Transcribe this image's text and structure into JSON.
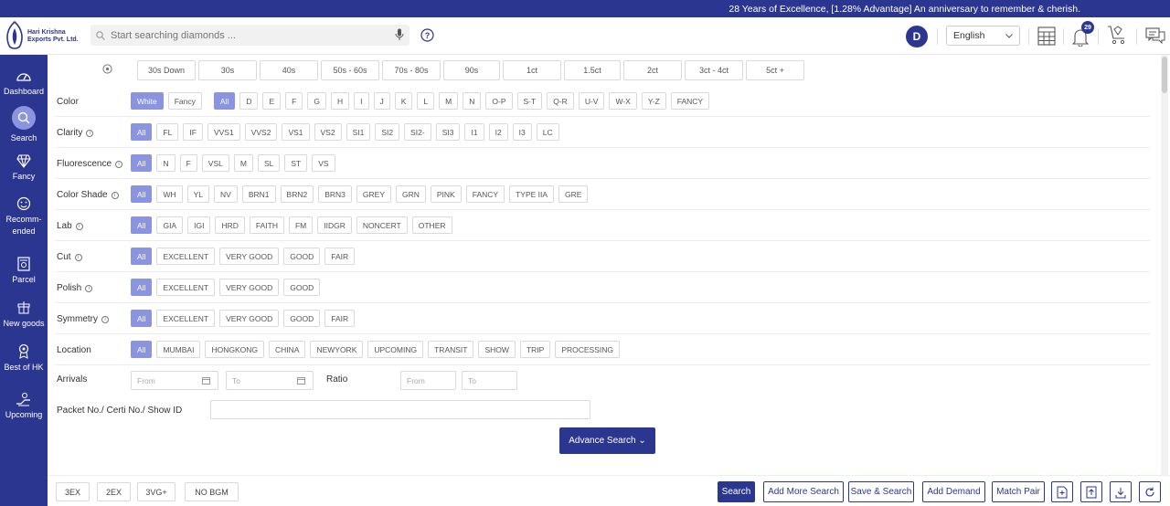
{
  "topbar": {
    "message": "28 Years of Excellence, [1.28% Advantage] An anniversary to remember & cherish."
  },
  "header": {
    "logo_line1": "Hari Krishna",
    "logo_line2": "Exports Pvt. Ltd.",
    "search_placeholder": "Start searching diamonds ...",
    "avatar_initial": "D",
    "language": "English",
    "notification_count": "29"
  },
  "sidebar": [
    {
      "label": "Dashboard",
      "icon": "dashboard-icon"
    },
    {
      "label": "Search",
      "icon": "search-icon",
      "active": true
    },
    {
      "label": "Fancy",
      "icon": "diamond-icon"
    },
    {
      "label": "Recomm-ended",
      "icon": "smile-icon"
    },
    {
      "label": "Parcel",
      "icon": "parcel-icon"
    },
    {
      "label": "New goods",
      "icon": "new-goods-icon"
    },
    {
      "label": "Best of HK",
      "icon": "medal-icon"
    },
    {
      "label": "Upcoming",
      "icon": "upcoming-icon"
    }
  ],
  "sizes": [
    "30s Down",
    "30s",
    "40s",
    "50s - 60s",
    "70s - 80s",
    "90s",
    "1ct",
    "1.5ct",
    "2ct",
    "3ct - 4ct",
    "5ct +"
  ],
  "filters": [
    {
      "label": "Color",
      "info": false,
      "chips": [
        "White",
        "Fancy",
        "All",
        "D",
        "E",
        "F",
        "G",
        "H",
        "I",
        "J",
        "K",
        "L",
        "M",
        "N",
        "O-P",
        "S-T",
        "Q-R",
        "U-V",
        "W-X",
        "Y-Z",
        "FANCY"
      ],
      "selected": [
        "White",
        "All"
      ]
    },
    {
      "label": "Clarity",
      "info": true,
      "chips": [
        "All",
        "FL",
        "IF",
        "VVS1",
        "VVS2",
        "VS1",
        "VS2",
        "SI1",
        "SI2",
        "SI2-",
        "SI3",
        "I1",
        "I2",
        "I3",
        "LC"
      ],
      "selected": [
        "All"
      ]
    },
    {
      "label": "Fluorescence",
      "info": true,
      "chips": [
        "All",
        "N",
        "F",
        "VSL",
        "M",
        "SL",
        "ST",
        "VS"
      ],
      "selected": [
        "All"
      ]
    },
    {
      "label": "Color Shade",
      "info": true,
      "chips": [
        "All",
        "WH",
        "YL",
        "NV",
        "BRN1",
        "BRN2",
        "BRN3",
        "GREY",
        "GRN",
        "PINK",
        "FANCY",
        "TYPE IIA",
        "GRE"
      ],
      "selected": [
        "All"
      ]
    },
    {
      "label": "Lab",
      "info": true,
      "chips": [
        "All",
        "GIA",
        "IGI",
        "HRD",
        "FAITH",
        "FM",
        "IIDGR",
        "NONCERT",
        "OTHER"
      ],
      "selected": [
        "All"
      ]
    },
    {
      "label": "Cut",
      "info": true,
      "chips": [
        "All",
        "EXCELLENT",
        "VERY GOOD",
        "GOOD",
        "FAIR"
      ],
      "selected": [
        "All"
      ]
    },
    {
      "label": "Polish",
      "info": true,
      "chips": [
        "All",
        "EXCELLENT",
        "VERY GOOD",
        "GOOD"
      ],
      "selected": [
        "All"
      ]
    },
    {
      "label": "Symmetry",
      "info": true,
      "chips": [
        "All",
        "EXCELLENT",
        "VERY GOOD",
        "GOOD",
        "FAIR"
      ],
      "selected": [
        "All"
      ]
    },
    {
      "label": "Location",
      "info": false,
      "chips": [
        "All",
        "MUMBAI",
        "HONGKONG",
        "CHINA",
        "NEWYORK",
        "UPCOMING",
        "TRANSIT",
        "SHOW",
        "TRIP",
        "PROCESSING"
      ],
      "selected": [
        "All"
      ]
    }
  ],
  "arrivals": {
    "label": "Arrivals",
    "from": "From",
    "to": "To"
  },
  "ratio": {
    "label": "Ratio",
    "from": "From",
    "to": "To"
  },
  "packet": {
    "label": "Packet No./ Certi No./ Show ID"
  },
  "advance_search": "Advance Search ⌄",
  "footer": {
    "quick": [
      "3EX",
      "2EX",
      "3VG+",
      "NO BGM"
    ],
    "buttons": [
      "Search",
      "Add More Search",
      "Save & Search",
      "Add Demand",
      "Match Pair"
    ]
  },
  "colors": {
    "primary": "#2b3690",
    "selected": "#8a94e0"
  }
}
